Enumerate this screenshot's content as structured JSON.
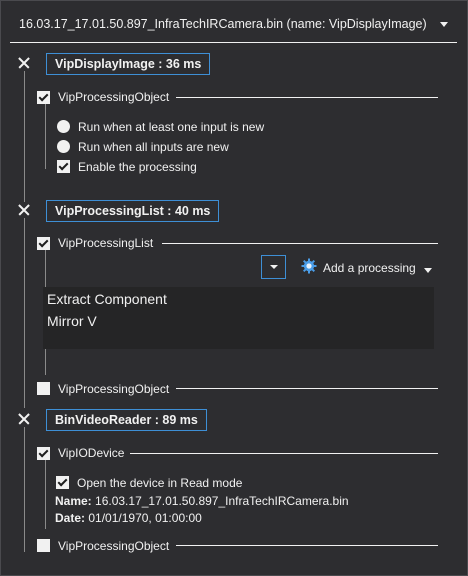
{
  "header": {
    "title": "16.03.17_17.01.50.897_InfraTechIRCamera.bin (name: VipDisplayImage)"
  },
  "sections": [
    {
      "badge": "VipDisplayImage : 36 ms",
      "object_label": "VipProcessingObject",
      "options": [
        {
          "type": "radio",
          "label": "Run when at least one input is new"
        },
        {
          "type": "radio",
          "label": "Run when all inputs are new"
        },
        {
          "type": "checkbox",
          "label": "Enable the processing",
          "checked": true
        }
      ]
    },
    {
      "badge": "VipProcessingList : 40 ms",
      "list_label": "VipProcessingList",
      "add_label": "Add a processing",
      "items": [
        "Extract Component",
        "Mirror V"
      ],
      "object_label": "VipProcessingObject"
    },
    {
      "badge": "BinVideoReader : 89 ms",
      "device_label": "VipIODevice",
      "read_mode_label": "Open the device in Read mode",
      "name_key": "Name:",
      "name_value": "16.03.17_17.01.50.897_InfraTechIRCamera.bin",
      "date_key": "Date:",
      "date_value": "01/01/1970, 01:00:00",
      "object_label": "VipProcessingObject"
    }
  ],
  "colors": {
    "background": "#2d2d30",
    "accent": "#3e8fd6",
    "text": "#f1f1f1",
    "list_bg": "#252526"
  },
  "icons": {
    "close": "close-x-icon",
    "gear": "gear-icon",
    "dropdown": "chevron-down-icon"
  }
}
